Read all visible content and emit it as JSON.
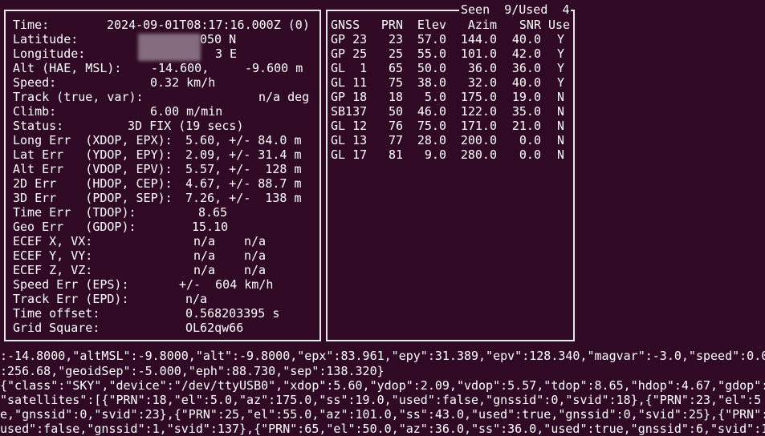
{
  "sky_header": {
    "seen_label": "Seen",
    "seen_count": "9",
    "used_label": "/Used",
    "used_count": "4"
  },
  "fix": {
    "time_label": "Time:",
    "time_value": "2024-09-01T08:17:16.000Z (0)",
    "latitude_label": "Latitude:",
    "latitude_value": "050 N",
    "longitude_label": "Longitude:",
    "longitude_value": "3 E",
    "alt_label": "Alt (HAE, MSL):",
    "alt_hae": "-14.600,",
    "alt_msl": "-9.600 m",
    "speed_label": "Speed:",
    "speed_value": "0.32 km/h",
    "track_label": "Track (true, var):",
    "track_value": "n/a deg",
    "climb_label": "Climb:",
    "climb_value": "6.00 m/min",
    "status_label": "Status:",
    "status_value": "3D FIX (19 secs)",
    "long_err_label": "Long Err  (XDOP, EPX):",
    "long_err_value": "5.60, +/- 84.0 m",
    "lat_err_label": "Lat Err   (YDOP, EPY):",
    "lat_err_value": "2.09, +/- 31.4 m",
    "alt_err_label": "Alt Err   (VDOP, EPV):",
    "alt_err_value": "5.57, +/-  128 m",
    "err_2d_label": "2D Err    (HDOP, CEP):",
    "err_2d_value": "4.67, +/- 88.7 m",
    "err_3d_label": "3D Err    (PDOP, SEP):",
    "err_3d_value": "7.26, +/-  138 m",
    "time_err_label": "Time Err  (TDOP):",
    "time_err_value": "8.65",
    "geo_err_label": "Geo Err   (GDOP):",
    "geo_err_value": "15.10",
    "ecef_x_label": "ECEF X, VX:",
    "ecef_x_value": "n/a",
    "ecef_vx_value": "n/a",
    "ecef_y_label": "ECEF Y, VY:",
    "ecef_y_value": "n/a",
    "ecef_vy_value": "n/a",
    "ecef_z_label": "ECEF Z, VZ:",
    "ecef_z_value": "n/a",
    "ecef_vz_value": "n/a",
    "speed_err_label": "Speed Err (EPS):",
    "speed_err_value": "+/-  604 km/h",
    "track_err_label": "Track Err (EPD):",
    "track_err_value": "n/a",
    "time_offset_label": "Time offset:",
    "time_offset_value": "0.568203395 s",
    "grid_square_label": "Grid Square:",
    "grid_square_value": "OL62qw66"
  },
  "satellites": {
    "columns": [
      "GNSS",
      "PRN",
      "Elev",
      "Azim",
      "SNR",
      "Use"
    ],
    "rows": [
      [
        "GP 23",
        "23",
        "57.0",
        "144.0",
        "40.0",
        "Y"
      ],
      [
        "GP 25",
        "25",
        "55.0",
        "101.0",
        "42.0",
        "Y"
      ],
      [
        "GL  1",
        "65",
        "50.0",
        "36.0",
        "36.0",
        "Y"
      ],
      [
        "GL 11",
        "75",
        "38.0",
        "32.0",
        "40.0",
        "Y"
      ],
      [
        "GP 18",
        "18",
        "5.0",
        "175.0",
        "19.0",
        "N"
      ],
      [
        "SB137",
        "50",
        "46.0",
        "122.0",
        "35.0",
        "N"
      ],
      [
        "GL 12",
        "76",
        "75.0",
        "171.0",
        "21.0",
        "N"
      ],
      [
        "GL 13",
        "77",
        "28.0",
        "200.0",
        "0.0",
        "N"
      ],
      [
        "GL 17",
        "81",
        "9.0",
        "280.0",
        "0.0",
        "N"
      ]
    ]
  },
  "raw_json_lines": [
    ":-14.8000,\"altMSL\":-9.8000,\"alt\":-9.8000,\"epx\":83.961,\"epy\":31.389,\"epv\":128.340,\"magvar\":-3.0,\"speed\":0.0",
    ":256.68,\"geoidSep\":-5.000,\"eph\":88.730,\"sep\":138.320}",
    "{\"class\":\"SKY\",\"device\":\"/dev/ttyUSB0\",\"xdop\":5.60,\"ydop\":2.09,\"vdop\":5.57,\"tdop\":8.65,\"hdop\":4.67,\"gdop\":",
    "\"satellites\":[{\"PRN\":18,\"el\":5.0,\"az\":175.0,\"ss\":19.0,\"used\":false,\"gnssid\":0,\"svid\":18},{\"PRN\":23,\"el\":5",
    "e,\"gnssid\":0,\"svid\":23},{\"PRN\":25,\"el\":55.0,\"az\":101.0,\"ss\":43.0,\"used\":true,\"gnssid\":0,\"svid\":25},{\"PRN\":",
    "used\":false,\"gnssid\":1,\"svid\":137},{\"PRN\":65,\"el\":50.0,\"az\":36.0,\"ss\":36.0,\"used\":true,\"gnssid\":6,\"svid\":1"
  ]
}
